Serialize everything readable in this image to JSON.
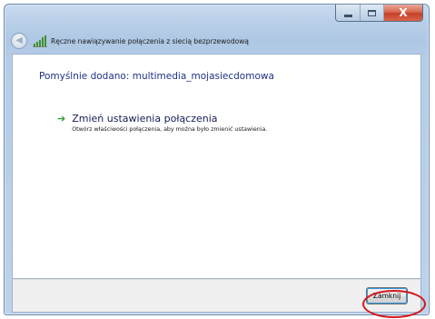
{
  "window": {
    "caption_buttons": {
      "close_glyph": "X"
    }
  },
  "navbar": {
    "title": "Ręczne nawiązywanie połączenia z siecią bezprzewodową",
    "icons": [
      "back-arrow-icon",
      "wireless-network-icon"
    ]
  },
  "content": {
    "headline": "Pomyślnie dodano: multimedia_mojasiecdomowa",
    "option": {
      "title": "Zmień ustawienia połączenia",
      "description": "Otwórz właściwości połączenia, aby można było zmienić ustawienia.",
      "icon": "green-arrow-icon"
    }
  },
  "footer": {
    "close_label": "Zamknij"
  },
  "colors": {
    "headline": "#1e3287",
    "option_arrow": "#2f9a34",
    "highlight": "#d4181e",
    "close_caption": "#c5402a"
  }
}
